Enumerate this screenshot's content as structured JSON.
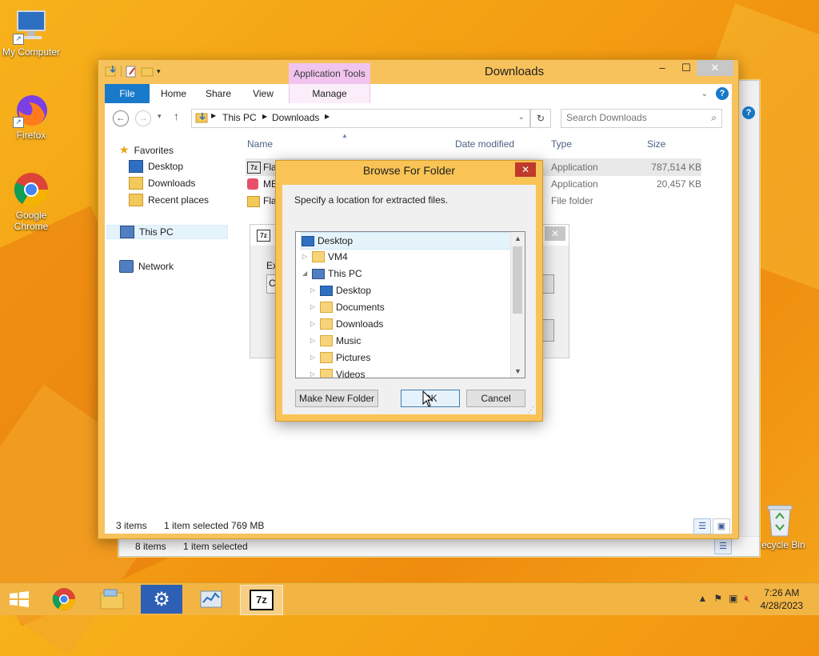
{
  "desktop": {
    "icons": [
      {
        "label": "My Computer",
        "icon": "computer-icon"
      },
      {
        "label": "Firefox",
        "icon": "firefox-icon"
      },
      {
        "label": "Google Chrome",
        "icon": "chrome-icon"
      },
      {
        "label": "Recycle Bin",
        "icon": "recycle-bin-icon"
      }
    ]
  },
  "back_window": {
    "status_items": "8 items",
    "status_selected": "1 item selected"
  },
  "explorer": {
    "title": "Downloads",
    "context_tab": "Application Tools",
    "tabs": {
      "file": "File",
      "home": "Home",
      "share": "Share",
      "view": "View",
      "manage": "Manage"
    },
    "breadcrumb": [
      "This PC",
      "Downloads"
    ],
    "search_placeholder": "Search Downloads",
    "nav": {
      "favorites": "Favorites",
      "desktop": "Desktop",
      "downloads": "Downloads",
      "recent": "Recent places",
      "this_pc": "This PC",
      "network": "Network"
    },
    "columns": {
      "name": "Name",
      "date": "Date modified",
      "type": "Type",
      "size": "Size"
    },
    "files": [
      {
        "name": "Flas",
        "type": "Application",
        "size": "787,514 KB"
      },
      {
        "name": "ME",
        "type": "Application",
        "size": "20,457 KB"
      },
      {
        "name": "Flas",
        "type": "File folder",
        "size": ""
      }
    ],
    "status": {
      "items": "3 items",
      "selected": "1 item selected",
      "size": "769 MB"
    }
  },
  "extract_dialog": {
    "label_fragment": "Ext",
    "path_fragment": "C:"
  },
  "browse_dialog": {
    "title": "Browse For Folder",
    "prompt": "Specify a location for extracted files.",
    "tree": [
      {
        "label": "Desktop",
        "level": 0,
        "expander": "",
        "selected": true
      },
      {
        "label": "VM4",
        "level": 1,
        "expander": "▷"
      },
      {
        "label": "This PC",
        "level": 1,
        "expander": "◢"
      },
      {
        "label": "Desktop",
        "level": 2,
        "expander": "▷"
      },
      {
        "label": "Documents",
        "level": 2,
        "expander": "▷"
      },
      {
        "label": "Downloads",
        "level": 2,
        "expander": "▷"
      },
      {
        "label": "Music",
        "level": 2,
        "expander": "▷"
      },
      {
        "label": "Pictures",
        "level": 2,
        "expander": "▷"
      },
      {
        "label": "Videos",
        "level": 2,
        "expander": "▷"
      }
    ],
    "new_folder_label": "Make New Folder",
    "ok_label": "OK",
    "cancel_label": "Cancel"
  },
  "taskbar": {
    "time": "7:26 AM",
    "date": "4/28/2023",
    "apps": [
      "start-icon",
      "chrome-icon",
      "file-explorer-icon",
      "settings-icon",
      "task-manager-icon",
      "7zip-icon"
    ]
  },
  "colors": {
    "accent": "#1979ca",
    "desktop": "#f39c12",
    "taskbar": "#f2b544"
  }
}
